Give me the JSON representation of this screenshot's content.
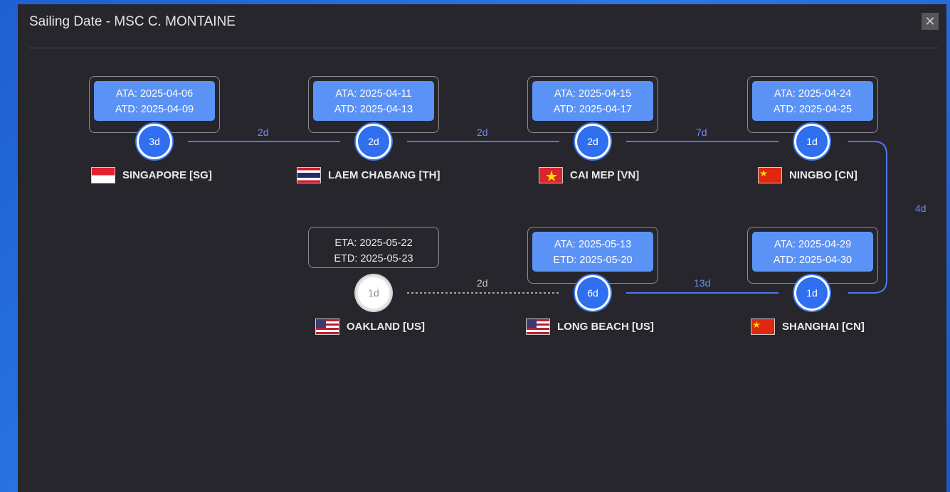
{
  "dialog": {
    "title": "Sailing Date  -  MSC C. MONTAINE",
    "close_label": "✕"
  },
  "colors": {
    "accent": "#5b92f5",
    "line": "#4f79ee",
    "dashed": "#cfcfcf"
  },
  "ports": [
    {
      "name": "SINGAPORE [SG]",
      "flag": "sg-flag-icon",
      "stay": "3d",
      "line1": "ATA: 2025-04-06",
      "line2": "ATD: 2025-04-09"
    },
    {
      "name": "LAEM CHABANG [TH]",
      "flag": "th-flag-icon",
      "stay": "2d",
      "line1": "ATA: 2025-04-11",
      "line2": "ATD: 2025-04-13"
    },
    {
      "name": "CAI MEP [VN]",
      "flag": "vn-flag-icon",
      "stay": "2d",
      "line1": "ATA: 2025-04-15",
      "line2": "ATD: 2025-04-17"
    },
    {
      "name": "NINGBO [CN]",
      "flag": "cn-flag-icon",
      "stay": "1d",
      "line1": "ATA: 2025-04-24",
      "line2": "ATD: 2025-04-25"
    },
    {
      "name": "SHANGHAI [CN]",
      "flag": "cn-flag-icon",
      "stay": "1d",
      "line1": "ATA: 2025-04-29",
      "line2": "ATD: 2025-04-30"
    },
    {
      "name": "LONG BEACH [US]",
      "flag": "us-flag-icon",
      "stay": "6d",
      "line1": "ATA: 2025-05-13",
      "line2": "ETD: 2025-05-20"
    },
    {
      "name": "OAKLAND [US]",
      "flag": "us-flag-icon",
      "stay": "1d",
      "line1": "ETA: 2025-05-22",
      "line2": "ETD: 2025-05-23"
    }
  ],
  "legs": [
    "2d",
    "2d",
    "7d",
    "4d",
    "13d",
    "2d"
  ]
}
